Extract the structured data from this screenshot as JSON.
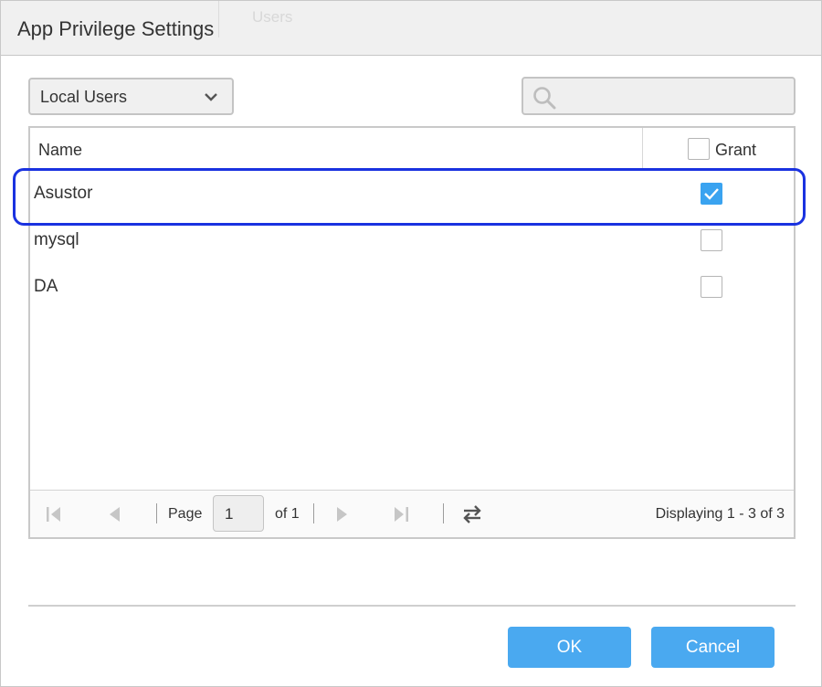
{
  "dialog": {
    "title": "App Privilege Settings",
    "background_tab": "Users"
  },
  "filter": {
    "selected": "Local Users",
    "chevron_icon": "chevron-down-icon"
  },
  "search": {
    "icon": "search-icon",
    "value": "",
    "placeholder": ""
  },
  "table": {
    "columns": [
      "Name",
      "Grant"
    ],
    "grant_all_checked": false,
    "rows": [
      {
        "name": "Asustor",
        "grant": true
      },
      {
        "name": "mysql",
        "grant": false
      },
      {
        "name": "DA",
        "grant": false
      }
    ]
  },
  "pager": {
    "page_label": "Page",
    "page_value": "1",
    "of_label": "of 1",
    "display_text": "Displaying 1 - 3 of 3",
    "icons": [
      "first-page-icon",
      "prev-page-icon",
      "next-page-icon",
      "last-page-icon",
      "refresh-icon"
    ]
  },
  "buttons": {
    "ok": "OK",
    "cancel": "Cancel"
  },
  "colors": {
    "accent": "#3aa3f0",
    "button": "#4aa9f0",
    "highlight": "#1a32e0"
  }
}
